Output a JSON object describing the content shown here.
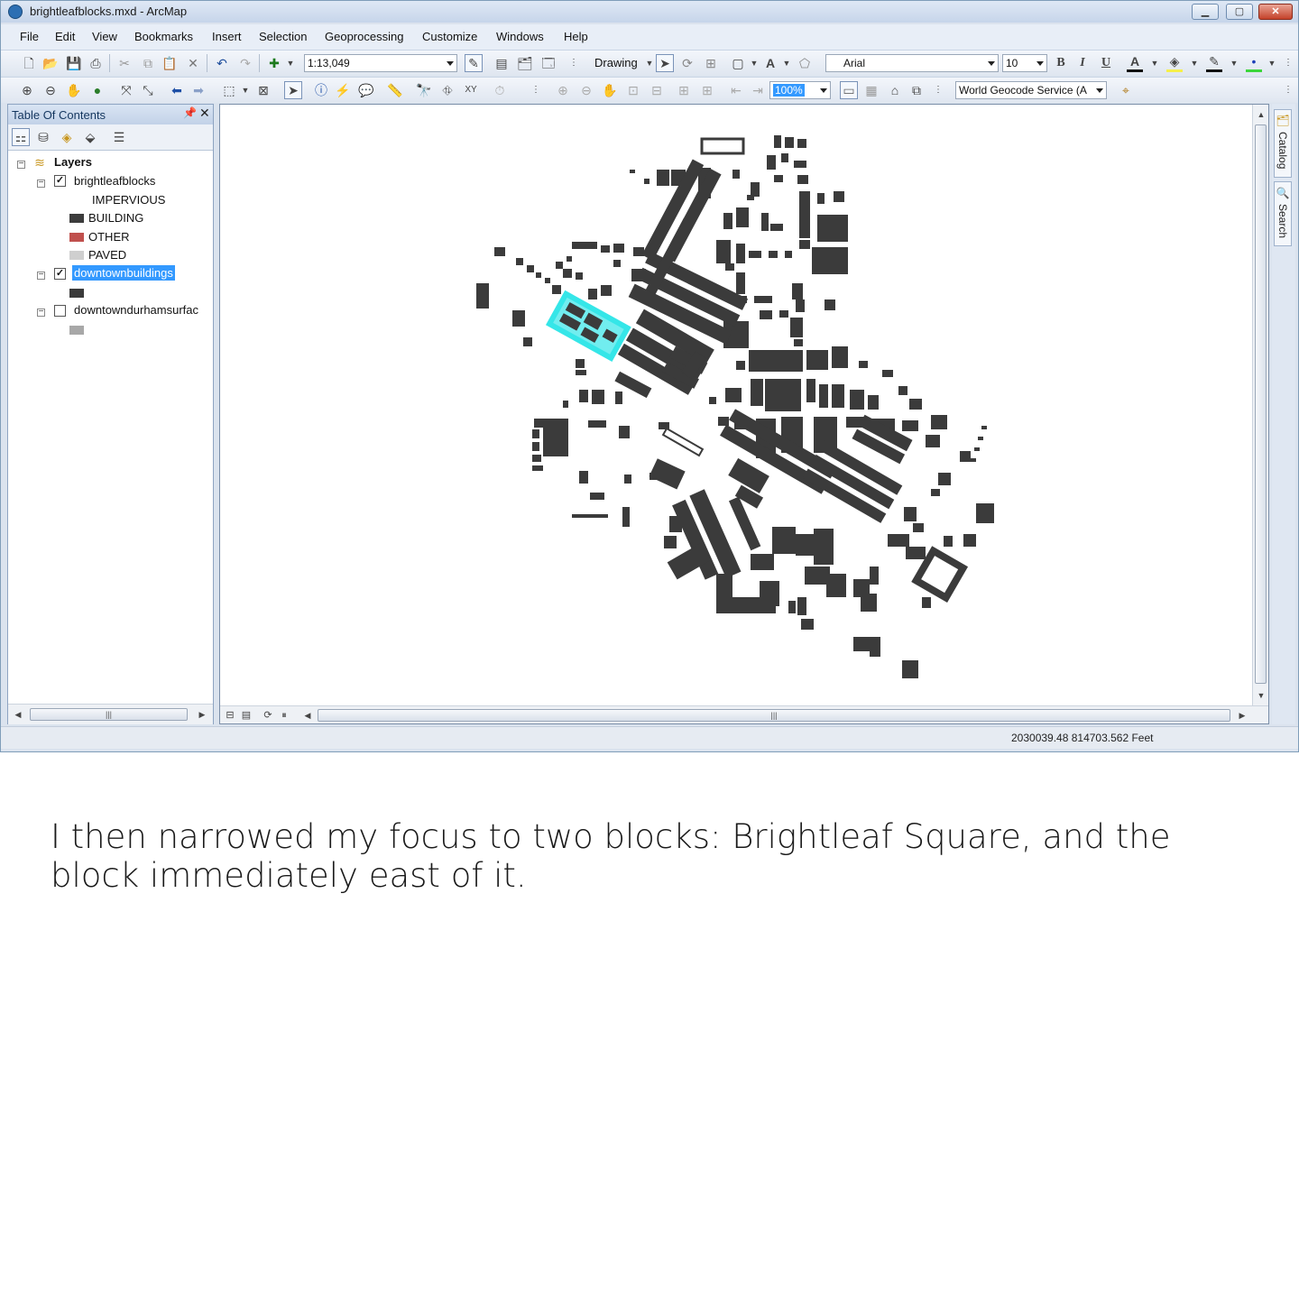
{
  "window": {
    "title": "brightleafblocks.mxd - ArcMap",
    "min_icon": "minimize-icon",
    "max_icon": "maximize-icon",
    "close_label": "✕"
  },
  "menu": [
    "File",
    "Edit",
    "View",
    "Bookmarks",
    "Insert",
    "Selection",
    "Geoprocessing",
    "Customize",
    "Windows",
    "Help"
  ],
  "toolbar": {
    "scale": "1:13,049",
    "drawing_label": "Drawing",
    "font_name": "Arial",
    "font_size": "10",
    "bold": "B",
    "italic": "I",
    "underline": "U",
    "zoom_percent": "100%",
    "geocode_service": "World Geocode Service (A"
  },
  "toc": {
    "title": "Table Of Contents",
    "root": "Layers",
    "layers": [
      {
        "name": "brightleafblocks",
        "checked": true,
        "selected": false,
        "field": "IMPERVIOUS",
        "classes": [
          {
            "label": "BUILDING",
            "color": "#3c3c3c"
          },
          {
            "label": "OTHER",
            "color": "#c0504d"
          },
          {
            "label": "PAVED",
            "color": "#cfcfcf"
          }
        ]
      },
      {
        "name": "downtownbuildings",
        "checked": true,
        "selected": true,
        "symbol_color": "#3a3a3a"
      },
      {
        "name": "downtowndurhamsurfac",
        "checked": false,
        "selected": false,
        "symbol_color": "#a8a8a8"
      }
    ]
  },
  "map": {
    "building_color": "#3b3b3b",
    "selection_color": "#35e6e8"
  },
  "side_tabs": [
    "Catalog",
    "Search"
  ],
  "status": {
    "coordinates": "2030039.48  814703.562 Feet"
  },
  "caption": "I then narrowed my focus to two blocks: Brightleaf Square, and the block immediately east of it.",
  "colors": {
    "titlebar": "#c6d5ea",
    "selected_layer_bg": "#3399ff"
  }
}
